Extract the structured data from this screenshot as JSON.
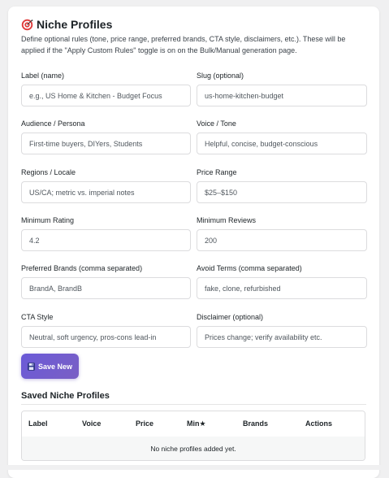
{
  "panel": {
    "title": "Niche Profiles",
    "title_icon": "target-icon",
    "description": "Define optional rules (tone, price range, preferred brands, CTA style, disclaimers, etc.). These will be applied if the \"Apply Custom Rules\" toggle is on on the Bulk/Manual generation page."
  },
  "form": {
    "label": {
      "label": "Label (name)",
      "placeholder": "e.g., US Home & Kitchen - Budget Focus"
    },
    "slug": {
      "label": "Slug (optional)",
      "placeholder": "us-home-kitchen-budget"
    },
    "audience": {
      "label": "Audience / Persona",
      "placeholder": "First-time buyers, DIYers, Students"
    },
    "voice": {
      "label": "Voice / Tone",
      "placeholder": "Helpful, concise, budget-conscious"
    },
    "regions": {
      "label": "Regions / Locale",
      "placeholder": "US/CA; metric vs. imperial notes"
    },
    "price_range": {
      "label": "Price Range",
      "placeholder": "$25–$150"
    },
    "min_rating": {
      "label": "Minimum Rating",
      "placeholder": "4.2"
    },
    "min_reviews": {
      "label": "Minimum Reviews",
      "placeholder": "200"
    },
    "preferred_brands": {
      "label": "Preferred Brands (comma separated)",
      "placeholder": "BrandA, BrandB"
    },
    "avoid_terms": {
      "label": "Avoid Terms (comma separated)",
      "placeholder": "fake, clone, refurbished"
    },
    "cta_style": {
      "label": "CTA Style",
      "placeholder": "Neutral, soft urgency, pros-cons lead-in"
    },
    "disclaimer": {
      "label": "Disclaimer (optional)",
      "placeholder": "Prices change; verify availability etc."
    },
    "save_button": {
      "label": "Save New",
      "icon": "floppy-disk-icon"
    }
  },
  "saved": {
    "title": "Saved Niche Profiles",
    "columns": [
      "Label",
      "Voice",
      "Price",
      "Min★",
      "Brands",
      "Actions"
    ],
    "empty_text": "No niche profiles added yet."
  },
  "colors": {
    "accent_gradient_start": "#6a5ad8",
    "accent_gradient_end": "#7a5fc4",
    "background": "#f0f0f1",
    "card": "#ffffff"
  }
}
